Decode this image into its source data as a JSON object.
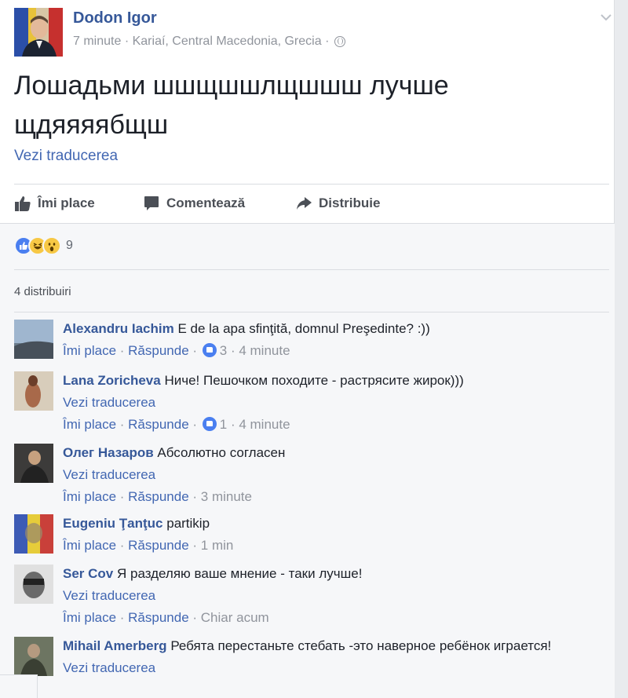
{
  "post": {
    "author": "Dodon Igor",
    "time": "7 minute",
    "location": "Kariaí, Central Macedonia, Grecia",
    "text": "Лошадьми шшщшшлщшшш лучше щдяяяябщш",
    "translate_label": "Vezi traducerea"
  },
  "actions": {
    "like": "Îmi place",
    "comment": "Comentează",
    "share": "Distribuie"
  },
  "reactions": {
    "icons": [
      "like-reaction-icon",
      "haha-reaction-icon",
      "wow-reaction-icon"
    ],
    "count": "9"
  },
  "shares": "4 distribuiri",
  "comments": [
    {
      "author": "Alexandru Iachim",
      "text": "E de la apa sfinţită, domnul Preşedinte? :))",
      "translate": "",
      "like": "Îmi place",
      "reply": "Răspunde",
      "likes": "3",
      "time": "4 minute"
    },
    {
      "author": "Lana Zoricheva",
      "text": "Ниче! Пешочком походите - растрясите жирок)))",
      "translate": "Vezi traducerea",
      "like": "Îmi place",
      "reply": "Răspunde",
      "likes": "1",
      "time": "4 minute"
    },
    {
      "author": "Олег Назаров",
      "text": "Абсолютно согласен",
      "translate": "Vezi traducerea",
      "like": "Îmi place",
      "reply": "Răspunde",
      "likes": "",
      "time": "3 minute"
    },
    {
      "author": "Eugeniu Ţanţuc",
      "text": "partikip",
      "translate": "",
      "like": "Îmi place",
      "reply": "Răspunde",
      "likes": "",
      "time": "1 min"
    },
    {
      "author": "Ser Cov",
      "text": "Я разделяю ваше мнение - таки лучше!",
      "translate": "Vezi traducerea",
      "like": "Îmi place",
      "reply": "Răspunde",
      "likes": "",
      "time": "Chiar acum"
    },
    {
      "author": "Mihail Amerberg",
      "text": "Ребята перестаньте стебать -это наверное ребёнок играется!",
      "translate": "Vezi traducerea",
      "like": "",
      "reply": "",
      "likes": "",
      "time": ""
    }
  ],
  "colors": {
    "link": "#365899",
    "accent": "#4267b2",
    "meta": "#90949c",
    "like_badge": "#4a7ff0"
  }
}
